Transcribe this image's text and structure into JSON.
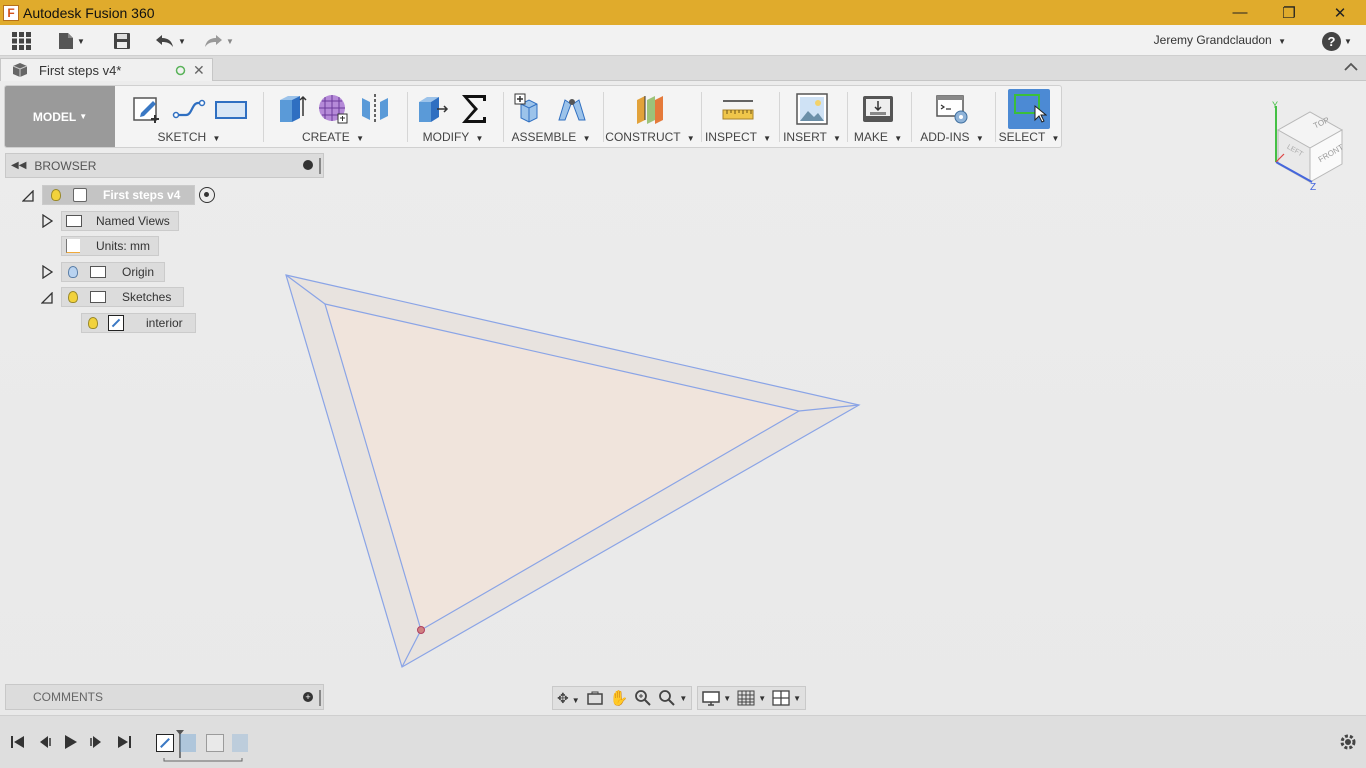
{
  "window": {
    "app_title": "Autodesk Fusion 360",
    "app_icon_letter": "F",
    "controls": {
      "minimize": "—",
      "restore": "❐",
      "close": "✕"
    }
  },
  "qab": {
    "user_name": "Jeremy Grandclaudon",
    "help_glyph": "?"
  },
  "document_tab": {
    "title": "First steps v4*"
  },
  "toolbar": {
    "workspace": "MODEL",
    "groups": [
      {
        "id": "sketch",
        "label": "SKETCH"
      },
      {
        "id": "create",
        "label": "CREATE"
      },
      {
        "id": "modify",
        "label": "MODIFY"
      },
      {
        "id": "assemble",
        "label": "ASSEMBLE"
      },
      {
        "id": "construct",
        "label": "CONSTRUCT"
      },
      {
        "id": "inspect",
        "label": "INSPECT"
      },
      {
        "id": "insert",
        "label": "INSERT"
      },
      {
        "id": "make",
        "label": "MAKE"
      },
      {
        "id": "addins",
        "label": "ADD-INS"
      },
      {
        "id": "select",
        "label": "SELECT"
      }
    ]
  },
  "browser": {
    "title": "BROWSER",
    "root": "First steps v4",
    "items": [
      {
        "label": "Named Views"
      },
      {
        "label": "Units: mm"
      },
      {
        "label": "Origin"
      },
      {
        "label": "Sketches"
      },
      {
        "label": "interior"
      }
    ]
  },
  "viewcube": {
    "top": "TOP",
    "front": "FRONT",
    "left": "LEFT",
    "axis_y": "Y",
    "axis_z": "Z"
  },
  "comments": {
    "title": "COMMENTS"
  },
  "colors": {
    "titlebar": "#e0ab2c",
    "sketch_line": "#8aa4e6",
    "profile_fill": "#f0e4dc",
    "select_blue": "#4c8ad4",
    "bulb": "#f2d23c"
  }
}
